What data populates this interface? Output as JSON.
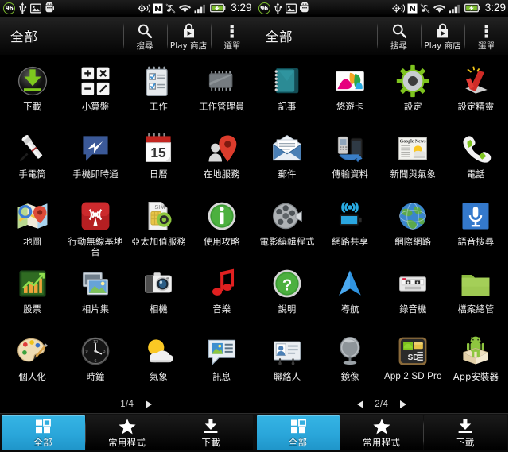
{
  "accent_color": "#2aa6da",
  "status_bar": {
    "battery_badge": "96",
    "clock": "3:29",
    "left_icons": [
      "battery-percent-badge",
      "usb-icon",
      "image-icon",
      "android-debug-icon"
    ],
    "right_icons": [
      "gps-location-icon",
      "nfc-icon",
      "silent-mute-icon",
      "wifi-icon",
      "signal-bars-icon",
      "battery-charging-icon"
    ]
  },
  "header": {
    "title": "全部",
    "actions": [
      {
        "label": "搜尋",
        "icon": "search-icon"
      },
      {
        "label": "Play 商店",
        "icon": "play-store-bag-icon"
      },
      {
        "label": "選單",
        "icon": "overflow-menu-icon"
      }
    ]
  },
  "tabs": [
    {
      "label": "全部",
      "icon": "grid-icon",
      "active": true
    },
    {
      "label": "常用程式",
      "icon": "star-icon",
      "active": false
    },
    {
      "label": "下載",
      "icon": "download-icon",
      "active": false
    }
  ],
  "screens": [
    {
      "page_indicator": "1/4",
      "prev_arrow_visible": false,
      "next_arrow_visible": true,
      "apps": [
        {
          "label": "下載",
          "icon": "download-circle-icon",
          "latin": false
        },
        {
          "label": "小算盤",
          "icon": "calculator-icon",
          "latin": false
        },
        {
          "label": "工作",
          "icon": "tasks-notepad-icon",
          "latin": false
        },
        {
          "label": "工作管理員",
          "icon": "task-manager-chip-icon",
          "latin": false
        },
        {
          "label": "手電筒",
          "icon": "flashlight-icon",
          "latin": false
        },
        {
          "label": "手機即時通",
          "icon": "messenger-bolt-icon",
          "latin": false
        },
        {
          "label": "日曆",
          "icon": "calendar-15-icon",
          "latin": false
        },
        {
          "label": "在地服務",
          "icon": "local-places-pin-icon",
          "latin": false
        },
        {
          "label": "地圖",
          "icon": "maps-icon",
          "latin": false
        },
        {
          "label": "行動無線基地台",
          "icon": "mobile-hotspot-tower-icon",
          "latin": false
        },
        {
          "label": "亞太加值服務",
          "icon": "sim-value-added-icon",
          "latin": false
        },
        {
          "label": "使用攻略",
          "icon": "info-guide-icon",
          "latin": false
        },
        {
          "label": "股票",
          "icon": "stocks-chart-icon",
          "latin": false
        },
        {
          "label": "相片集",
          "icon": "gallery-photos-icon",
          "latin": false
        },
        {
          "label": "相機",
          "icon": "camera-icon",
          "latin": false
        },
        {
          "label": "音樂",
          "icon": "music-note-icon",
          "latin": false
        },
        {
          "label": "個人化",
          "icon": "personalize-palette-icon",
          "latin": false
        },
        {
          "label": "時鐘",
          "icon": "clock-icon",
          "latin": false
        },
        {
          "label": "氣象",
          "icon": "weather-sun-cloud-icon",
          "latin": false
        },
        {
          "label": "訊息",
          "icon": "messages-bubble-icon",
          "latin": false
        }
      ]
    },
    {
      "page_indicator": "2/4",
      "prev_arrow_visible": true,
      "next_arrow_visible": true,
      "apps": [
        {
          "label": "記事",
          "icon": "notes-notebook-icon",
          "latin": false
        },
        {
          "label": "悠遊卡",
          "icon": "easycard-icon",
          "latin": false
        },
        {
          "label": "設定",
          "icon": "settings-gear-icon",
          "latin": false
        },
        {
          "label": "設定精靈",
          "icon": "setup-wizard-check-icon",
          "latin": false
        },
        {
          "label": "郵件",
          "icon": "mail-envelope-icon",
          "latin": false
        },
        {
          "label": "傳輸資料",
          "icon": "transfer-data-icon",
          "latin": false
        },
        {
          "label": "新聞與氣象",
          "icon": "news-weather-icon",
          "latin": false
        },
        {
          "label": "電話",
          "icon": "phone-handset-icon",
          "latin": false
        },
        {
          "label": "電影編輯程式",
          "icon": "movie-editor-reel-icon",
          "latin": false
        },
        {
          "label": "網路共享",
          "icon": "tethering-icon",
          "latin": false
        },
        {
          "label": "網際網路",
          "icon": "browser-globe-icon",
          "latin": false
        },
        {
          "label": "語音搜尋",
          "icon": "voice-search-mic-icon",
          "latin": false
        },
        {
          "label": "說明",
          "icon": "help-question-icon",
          "latin": false
        },
        {
          "label": "導航",
          "icon": "navigation-arrow-icon",
          "latin": false
        },
        {
          "label": "錄音機",
          "icon": "voice-recorder-tape-icon",
          "latin": false
        },
        {
          "label": "檔案總管",
          "icon": "file-manager-folder-icon",
          "latin": false
        },
        {
          "label": "聯絡人",
          "icon": "contacts-card-icon",
          "latin": false
        },
        {
          "label": "鏡像",
          "icon": "mirror-icon",
          "latin": false
        },
        {
          "label": "App 2 SD Pro",
          "icon": "app2sd-icon",
          "latin": true
        },
        {
          "label": "App安裝器",
          "icon": "app-installer-android-icon",
          "latin": false
        }
      ]
    }
  ]
}
